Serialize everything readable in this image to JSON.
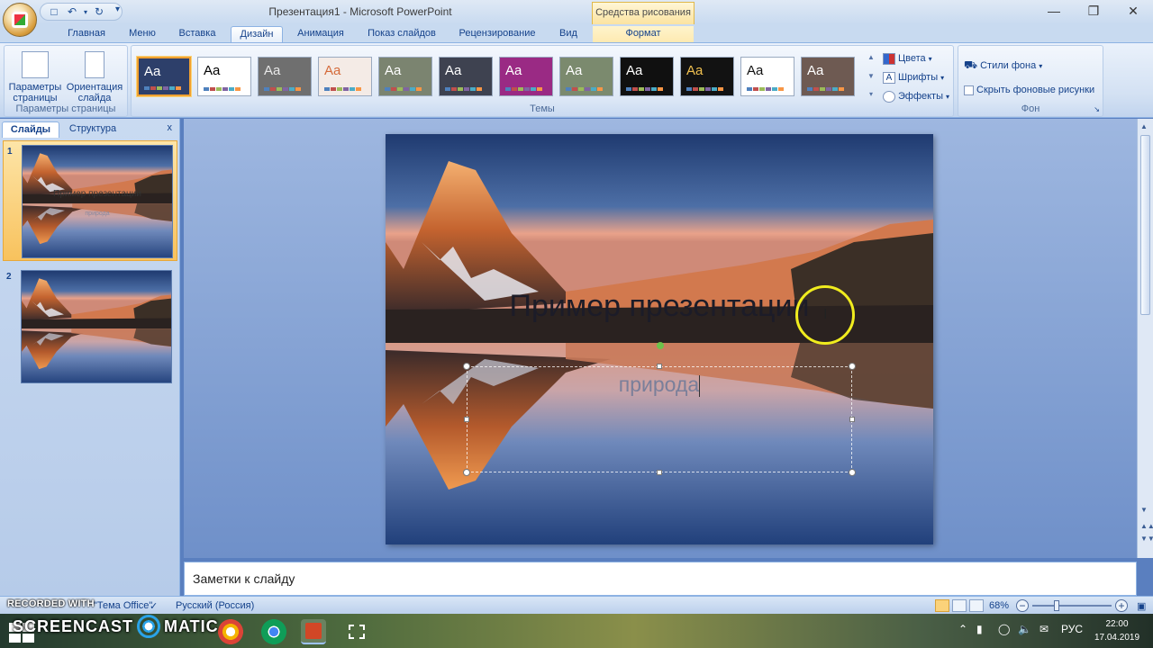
{
  "window": {
    "title": "Презентация1 - Microsoft PowerPoint",
    "contextual_tab_group": "Средства рисования"
  },
  "qat": {
    "save": "💾",
    "undo": "↶",
    "redo": "↻",
    "more": "▾"
  },
  "tabs": [
    "Главная",
    "Меню",
    "Вставка",
    "Дизайн",
    "Анимация",
    "Показ слайдов",
    "Рецензирование",
    "Вид",
    "Формат"
  ],
  "active_tab": "Дизайн",
  "ribbon": {
    "page_setup": {
      "page_params_label": "Параметры страницы",
      "orientation_label": "Ориентация слайда",
      "group_label": "Параметры страницы"
    },
    "themes": {
      "group_label": "Темы",
      "items": [
        {
          "label": "Aa",
          "bg": "#2d3f6a",
          "fg": "#ffffff"
        },
        {
          "label": "Aa",
          "bg": "#ffffff",
          "fg": "#000000"
        },
        {
          "label": "Aa",
          "bg": "#6f6f6f",
          "fg": "#e8e8e8"
        },
        {
          "label": "Aa",
          "bg": "#f4ebe6",
          "fg": "#d46a3a"
        },
        {
          "label": "Aa",
          "bg": "#7b8470",
          "fg": "#ffffff"
        },
        {
          "label": "Aa",
          "bg": "#3e4250",
          "fg": "#ffffff"
        },
        {
          "label": "Aa",
          "bg": "#9a2a84",
          "fg": "#ffffff"
        },
        {
          "label": "Aa",
          "bg": "#7b8a6e",
          "fg": "#ffffff"
        },
        {
          "label": "Aa",
          "bg": "#101010",
          "fg": "#ffffff"
        },
        {
          "label": "Aa",
          "bg": "#121212",
          "fg": "#f0c050"
        },
        {
          "label": "Aa",
          "bg": "#ffffff",
          "fg": "#111111"
        },
        {
          "label": "Aa",
          "bg": "#6e5a52",
          "fg": "#ffffff"
        }
      ]
    },
    "theme_options": {
      "colors_label": "Цвета",
      "fonts_label": "Шрифты",
      "effects_label": "Эффекты"
    },
    "background": {
      "group_label": "Фон",
      "styles_label": "Стили фона",
      "hide_graphics_label": "Скрыть фоновые рисунки"
    }
  },
  "left_pane": {
    "tab_slides": "Слайды",
    "tab_outline": "Структура",
    "close": "x",
    "slides": [
      {
        "number": "1",
        "title": "Пример презентации",
        "subtitle": "природа"
      },
      {
        "number": "2",
        "title": "",
        "subtitle": ""
      }
    ]
  },
  "slide": {
    "title": "Пример презентации",
    "subtitle": "природа"
  },
  "notes": {
    "placeholder": "Заметки к слайду"
  },
  "status": {
    "left_text": "RECORDED WITH",
    "theme_text": "\"Тема Office\"",
    "language": "Русский (Россия)",
    "zoom": "68%"
  },
  "taskbar": {
    "watermark": "SCREENCAST",
    "watermark2": "MATIC",
    "lang": "РУС",
    "time": "22:00",
    "date": "17.04.2019"
  }
}
